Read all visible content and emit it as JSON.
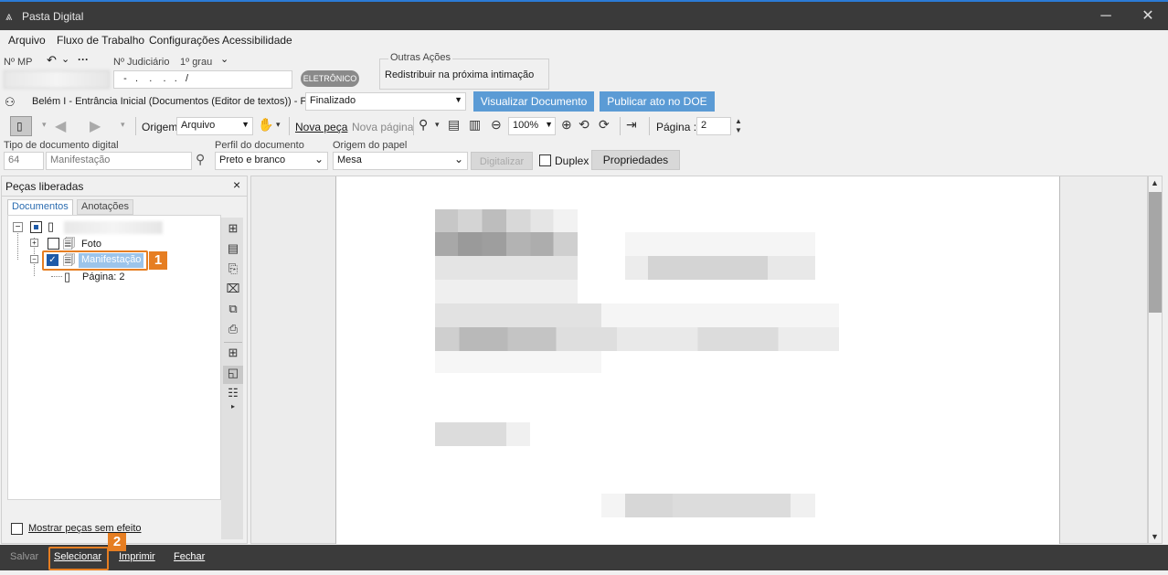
{
  "window": {
    "title": "Pasta Digital",
    "logo_icon": "scales-logo-icon",
    "minimize": "─",
    "close": "✕"
  },
  "menu": [
    "Arquivo",
    "Fluxo de Trabalho",
    "Configurações",
    "Acessibilidade"
  ],
  "header": {
    "mp_label": "Nº MP",
    "judiciario_label": "Nº Judiciário",
    "grau_label": "1º grau",
    "judiciario_value": "  -   .    .    .   .   /",
    "eletronico_badge": "ELETRÔNICO",
    "outras_acoes_title": "Outras Ações",
    "outras_acoes_item": "Redistribuir na próxima intimação"
  },
  "fila": {
    "description": "Belém I - Entrância Inicial (Documentos (Editor de textos)) - Fila",
    "value": "Finalizado",
    "visualizar_btn": "Visualizar Documento",
    "publicar_btn": "Publicar ato no DOE"
  },
  "toolbar": {
    "origem_label": "Origem",
    "origem_value": "Arquivo",
    "nova_peca": "Nova peça",
    "nova_pagina": "Nova página",
    "zoom_value": "100%",
    "pagina_label": "Página :",
    "pagina_value": "2"
  },
  "docfields": {
    "tipo_label": "Tipo de documento digital",
    "tipo_code": "64",
    "tipo_value": "Manifestação",
    "perfil_label": "Perfil do documento",
    "perfil_value": "Preto e branco",
    "origem_papel_label": "Origem do papel",
    "origem_papel_value": "Mesa",
    "digitalizar_btn": "Digitalizar",
    "duplex_label": "Duplex",
    "propriedades_btn": "Propriedades"
  },
  "left_panel": {
    "title": "Peças liberadas",
    "close": "×",
    "tabs": [
      "Documentos",
      "Anotações"
    ],
    "tree": {
      "foto": "Foto",
      "manifestacao": "Manifestação",
      "pagina": "Página: 2"
    },
    "mostrar_label": "Mostrar peças sem efeito"
  },
  "badges": {
    "one": "1",
    "two": "2"
  },
  "statusbar": {
    "salvar": "Salvar",
    "selecionar": "Selecionar",
    "imprimir": "Imprimir",
    "fechar": "Fechar"
  },
  "colors": {
    "accent_blue": "#5b9bd5",
    "highlight_orange": "#e67e22",
    "title_bg": "#3a3a3a"
  }
}
